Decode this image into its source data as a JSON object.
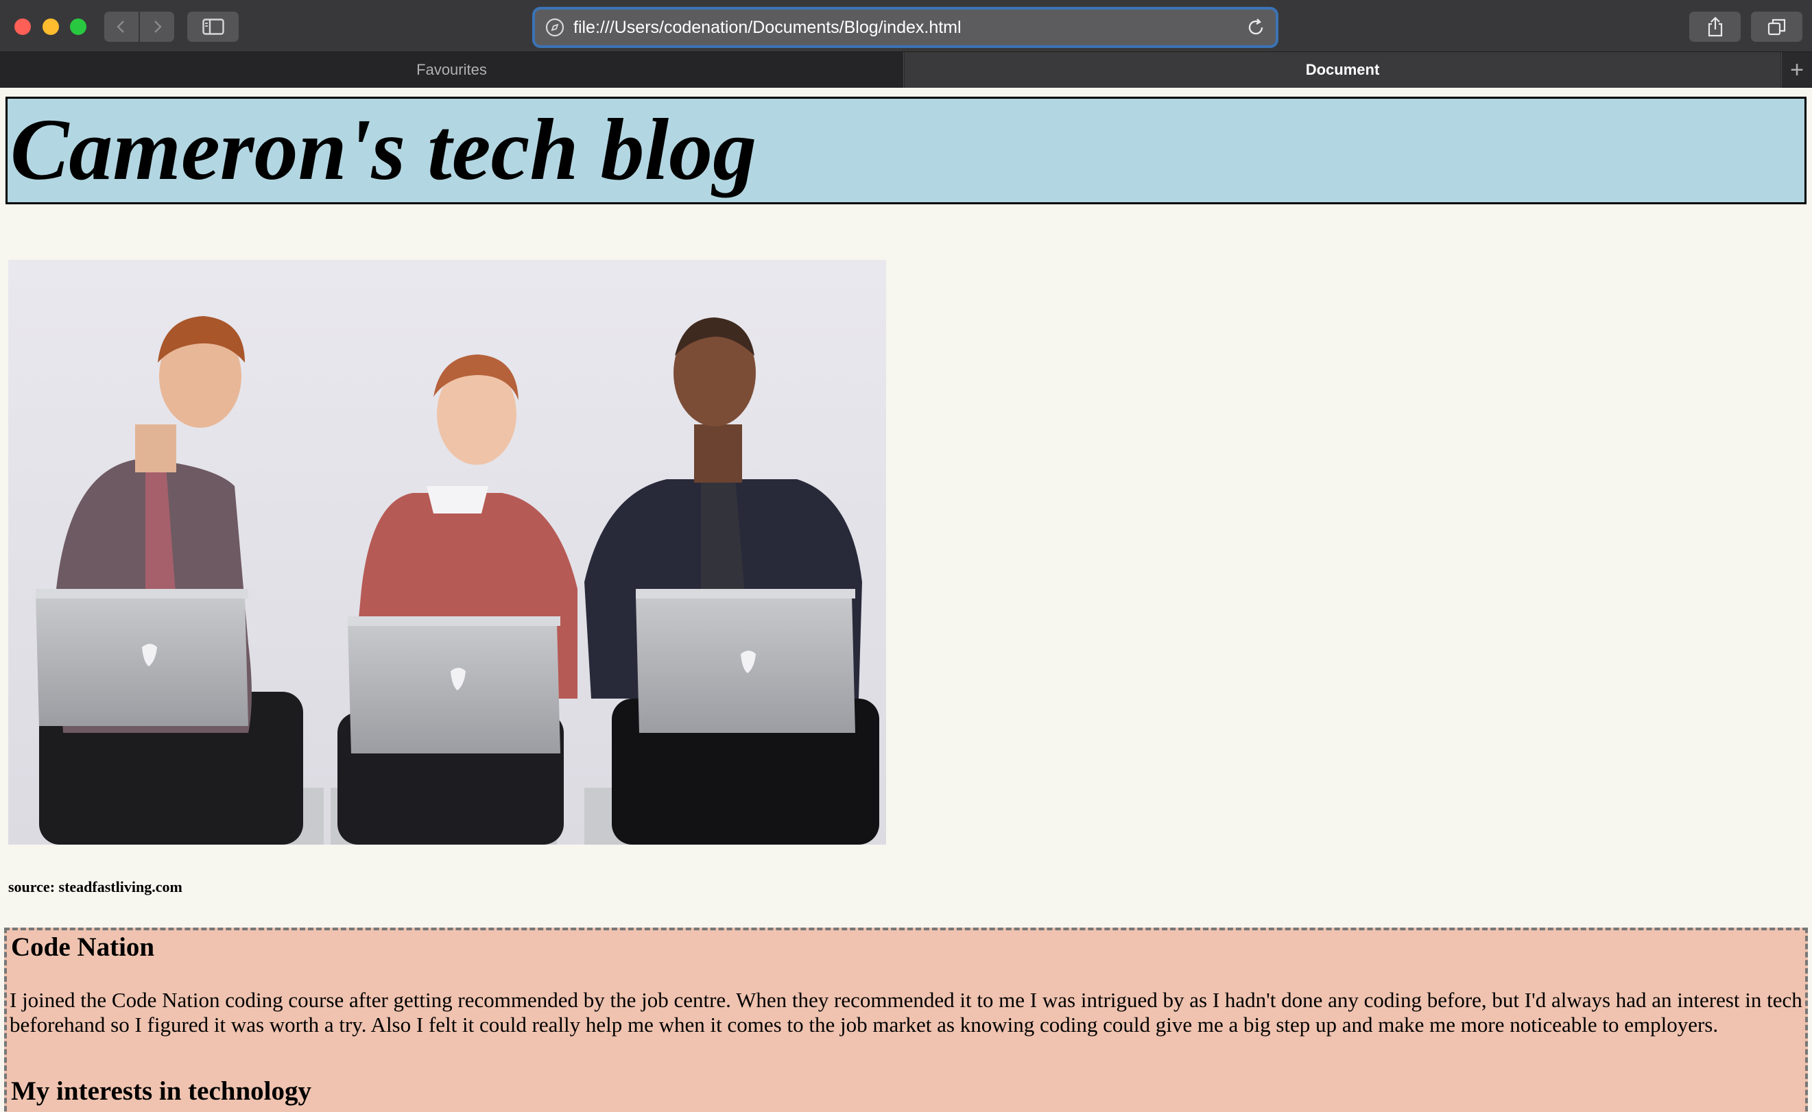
{
  "browser": {
    "url": "file:///Users/codenation/Documents/Blog/index.html",
    "tabs": [
      {
        "label": "Favourites",
        "active": false
      },
      {
        "label": "Document",
        "active": true
      }
    ]
  },
  "page": {
    "title": "Cameron's tech blog",
    "image_source": "source: steadfastliving.com",
    "section": {
      "heading": "Code Nation",
      "paragraph": "I joined the Code Nation coding course after getting recommended by the job centre. When they recommended it to me I was intrigued by as I hadn't done any coding before, but I'd always had an interest in tech beforehand so I figured it was worth a try. Also I felt it could really help me when it comes to the job market as knowing coding could give me a big step up and make me more noticeable to employers.",
      "heading2": "My interests in technology"
    }
  },
  "colors": {
    "header_bg": "#b3d7e2",
    "section_bg": "#efc3b0",
    "page_bg": "#f7f6ef",
    "url_focus_ring": "#3b73b5"
  }
}
